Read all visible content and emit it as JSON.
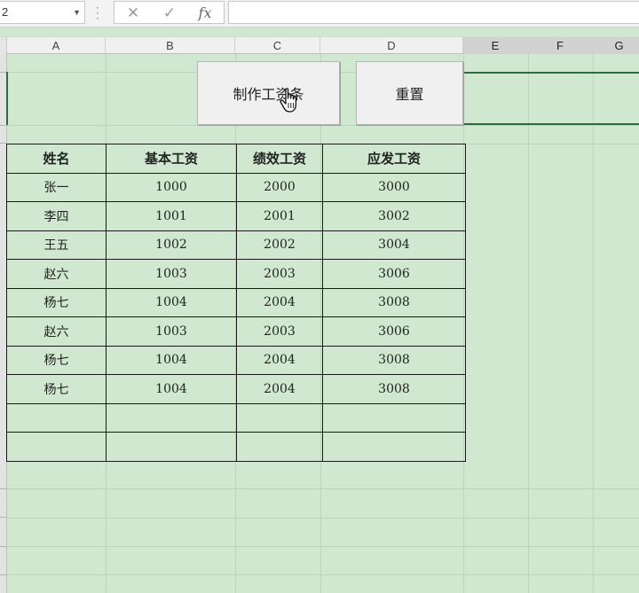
{
  "formula_bar": {
    "name_box": "2",
    "cancel_glyph": "✕",
    "enter_glyph": "✓",
    "fx_label": "fx",
    "formula": ""
  },
  "columns": [
    "A",
    "B",
    "C",
    "D",
    "E",
    "F",
    "G"
  ],
  "selected_columns": [
    "E",
    "F",
    "G"
  ],
  "buttons": {
    "make_payslip": "制作工资条",
    "reset": "重置"
  },
  "table": {
    "headers": [
      "姓名",
      "基本工资",
      "绩效工资",
      "应发工资"
    ],
    "rows": [
      [
        "张一",
        "1000",
        "2000",
        "3000"
      ],
      [
        "李四",
        "1001",
        "2001",
        "3002"
      ],
      [
        "王五",
        "1002",
        "2002",
        "3004"
      ],
      [
        "赵六",
        "1003",
        "2003",
        "3006"
      ],
      [
        "杨七",
        "1004",
        "2004",
        "3008"
      ],
      [
        "赵六",
        "1003",
        "2003",
        "3006"
      ],
      [
        "杨七",
        "1004",
        "2004",
        "3008"
      ],
      [
        "杨七",
        "1004",
        "2004",
        "3008"
      ],
      [
        "",
        "",
        "",
        ""
      ],
      [
        "",
        "",
        "",
        ""
      ]
    ]
  },
  "colors": {
    "sheet_background": "#cfe8cf",
    "selection_border": "#2a6e3f"
  },
  "icons": {
    "cursor": "hand-pointer-icon"
  }
}
